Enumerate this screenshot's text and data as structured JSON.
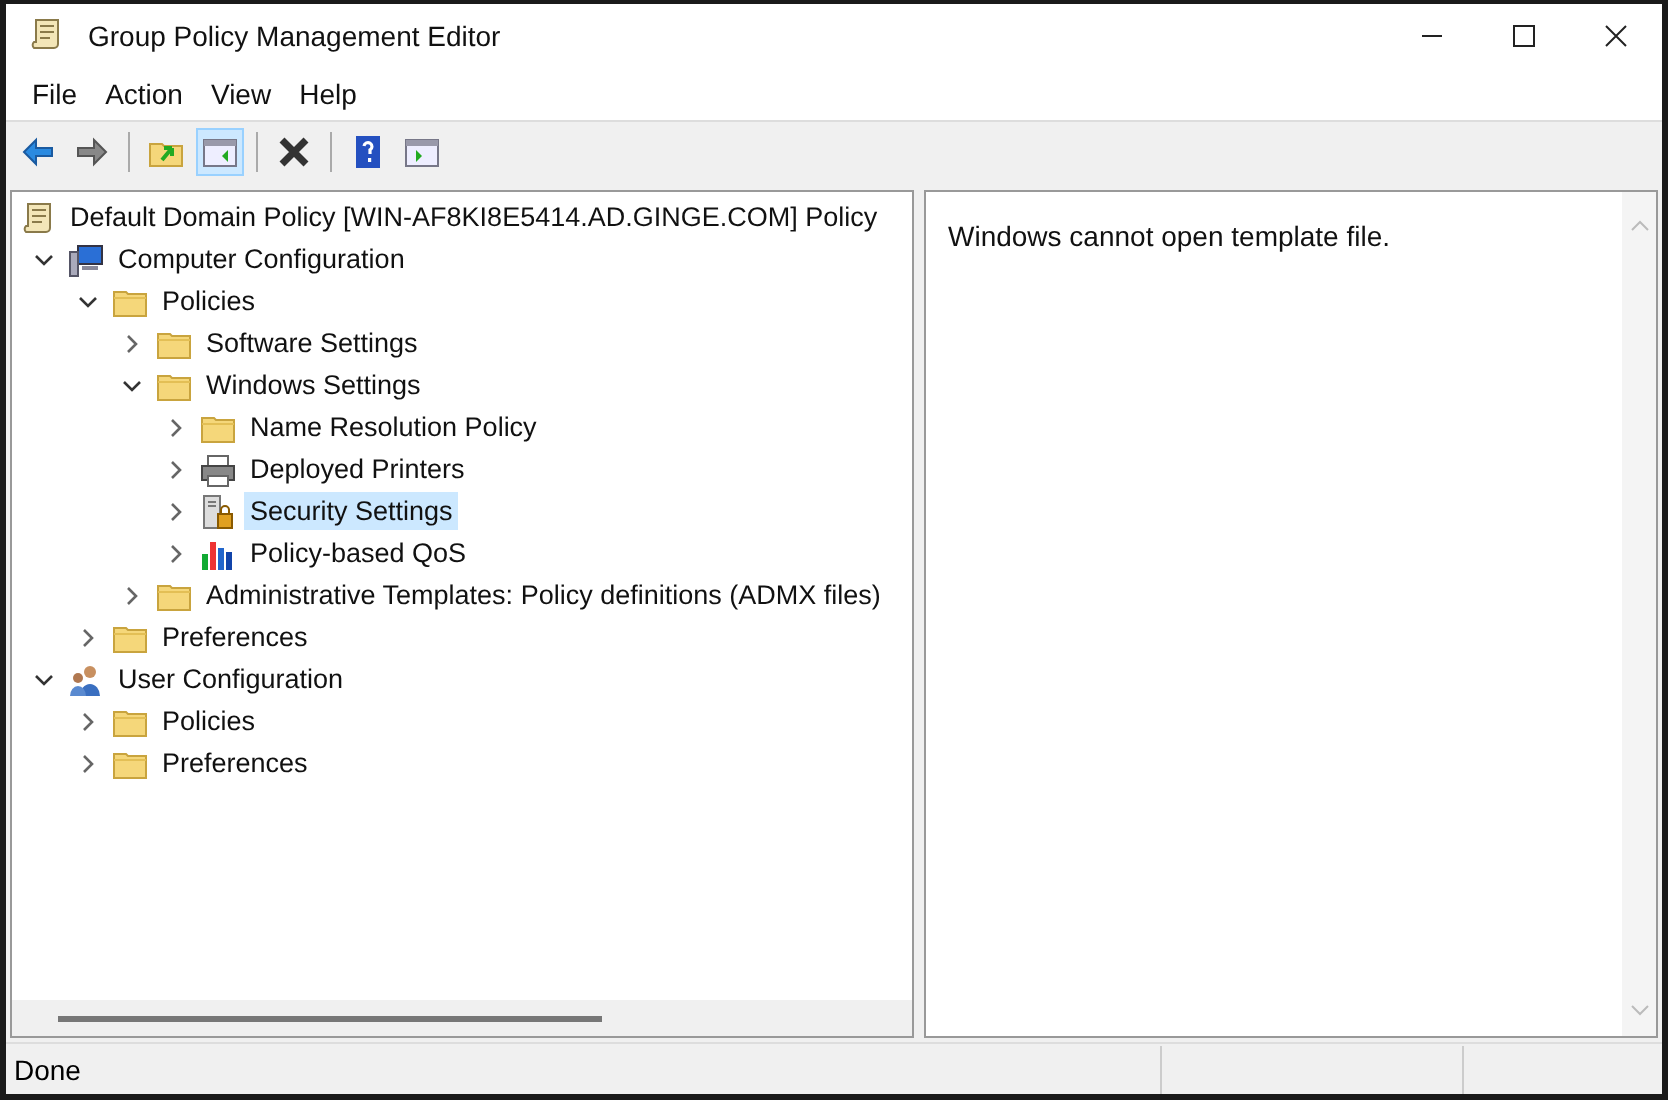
{
  "window": {
    "title": "Group Policy Management Editor"
  },
  "menu": [
    "File",
    "Action",
    "View",
    "Help"
  ],
  "toolbar": [
    {
      "kind": "back"
    },
    {
      "kind": "forward"
    },
    {
      "kind": "sep"
    },
    {
      "kind": "up"
    },
    {
      "kind": "tree",
      "selected": true
    },
    {
      "kind": "sep"
    },
    {
      "kind": "delete"
    },
    {
      "kind": "sep"
    },
    {
      "kind": "help"
    },
    {
      "kind": "pane"
    }
  ],
  "tree": {
    "label": "Default Domain Policy [WIN-AF8KI8E5414.AD.GINGE.COM] Policy",
    "kind": "scroll",
    "children": [
      {
        "label": "Computer Configuration",
        "kind": "computer",
        "expanded": true,
        "selected": false,
        "children": [
          {
            "label": "Policies",
            "kind": "folder",
            "expanded": true,
            "selected": false,
            "children": [
              {
                "label": "Software Settings",
                "kind": "folder",
                "expanded": false,
                "selected": false
              },
              {
                "label": "Windows Settings",
                "kind": "folder",
                "expanded": true,
                "selected": false,
                "children": [
                  {
                    "label": "Name Resolution Policy",
                    "kind": "folder",
                    "expanded": false,
                    "selected": false
                  },
                  {
                    "label": "Deployed Printers",
                    "kind": "printer",
                    "expanded": false,
                    "selected": false
                  },
                  {
                    "label": "Security Settings",
                    "kind": "security",
                    "expanded": false,
                    "selected": true
                  },
                  {
                    "label": "Policy-based QoS",
                    "kind": "chart",
                    "expanded": false,
                    "selected": false
                  }
                ]
              },
              {
                "label": "Administrative Templates: Policy definitions (ADMX files)",
                "kind": "folder",
                "expanded": false,
                "selected": false
              }
            ]
          },
          {
            "label": "Preferences",
            "kind": "folder",
            "expanded": false,
            "selected": false
          }
        ]
      },
      {
        "label": "User Configuration",
        "kind": "user",
        "expanded": true,
        "selected": false,
        "children": [
          {
            "label": "Policies",
            "kind": "folder",
            "expanded": false,
            "selected": false
          },
          {
            "label": "Preferences",
            "kind": "folder",
            "expanded": false,
            "selected": false
          }
        ]
      }
    ]
  },
  "detail": {
    "message": "Windows cannot open template file."
  },
  "status_bar": {
    "text": "Done"
  }
}
